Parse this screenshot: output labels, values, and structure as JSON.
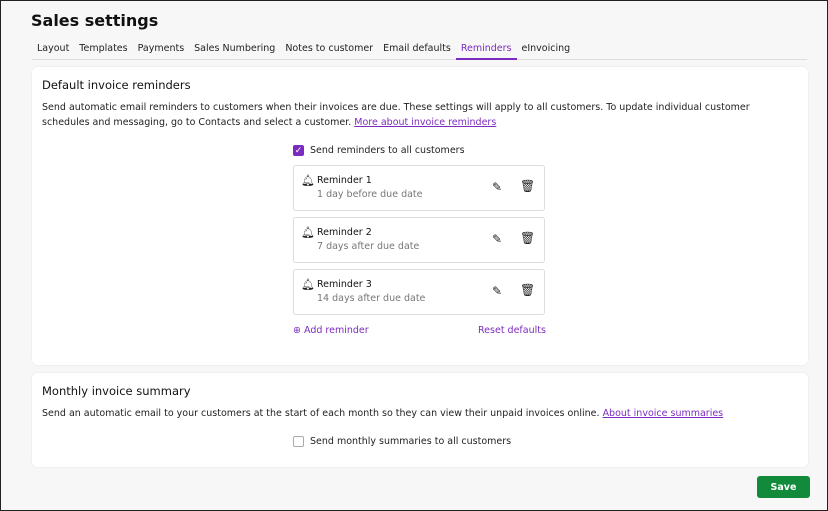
{
  "title": "Sales settings",
  "tabs": [
    "Layout",
    "Templates",
    "Payments",
    "Sales Numbering",
    "Notes to customer",
    "Email defaults",
    "Reminders",
    "eInvoicing"
  ],
  "reminders_card": {
    "heading": "Default invoice reminders",
    "description": "Send automatic email reminders to customers when their invoices are due. These settings will apply to all customers. To update individual customer schedules and messaging, go to Contacts and select a customer.",
    "link": "More about invoice reminders",
    "checkbox_label": "Send reminders to all customers",
    "checkbox_checked": true,
    "reminders": [
      {
        "name": "Reminder 1",
        "timing": "1 day before due date"
      },
      {
        "name": "Reminder 2",
        "timing": "7 days after due date"
      },
      {
        "name": "Reminder 3",
        "timing": "14 days after due date"
      }
    ],
    "add_label": "Add reminder",
    "reset_label": "Reset defaults"
  },
  "summary_card": {
    "heading": "Monthly invoice summary",
    "description": "Send an automatic email to your customers at the start of each month so they can view their unpaid invoices online.",
    "link": "About invoice summaries",
    "checkbox_label": "Send monthly summaries to all customers",
    "checkbox_checked": false
  },
  "save_label": "Save"
}
